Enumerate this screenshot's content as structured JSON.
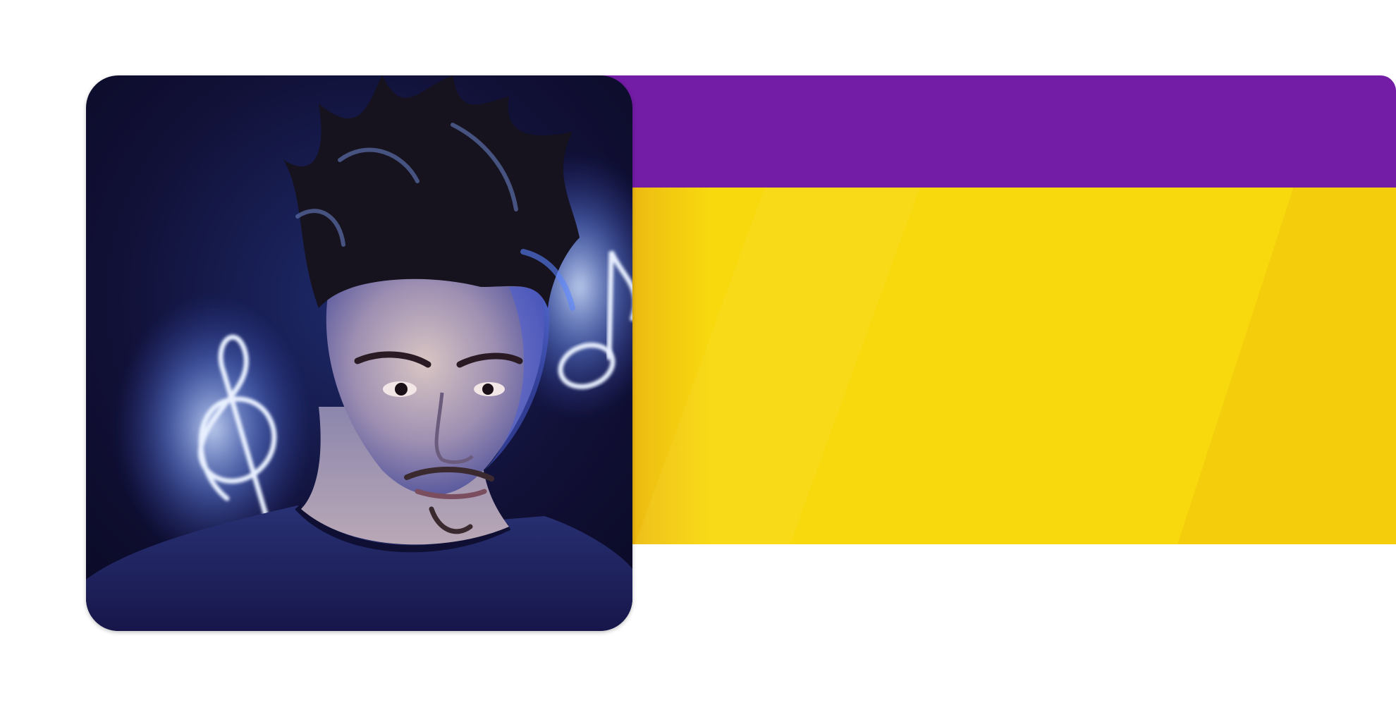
{
  "colors": {
    "banner_top": "#731ca6",
    "banner_bottom": "#f8d90e",
    "photo_bg": "#0f0d32",
    "shirt": "#1c1a4e",
    "glow": "#8fb7ff"
  },
  "artist_image": {
    "subject": "artist-portrait",
    "decorations": [
      "music-note-icon",
      "treble-clef-icon"
    ]
  }
}
